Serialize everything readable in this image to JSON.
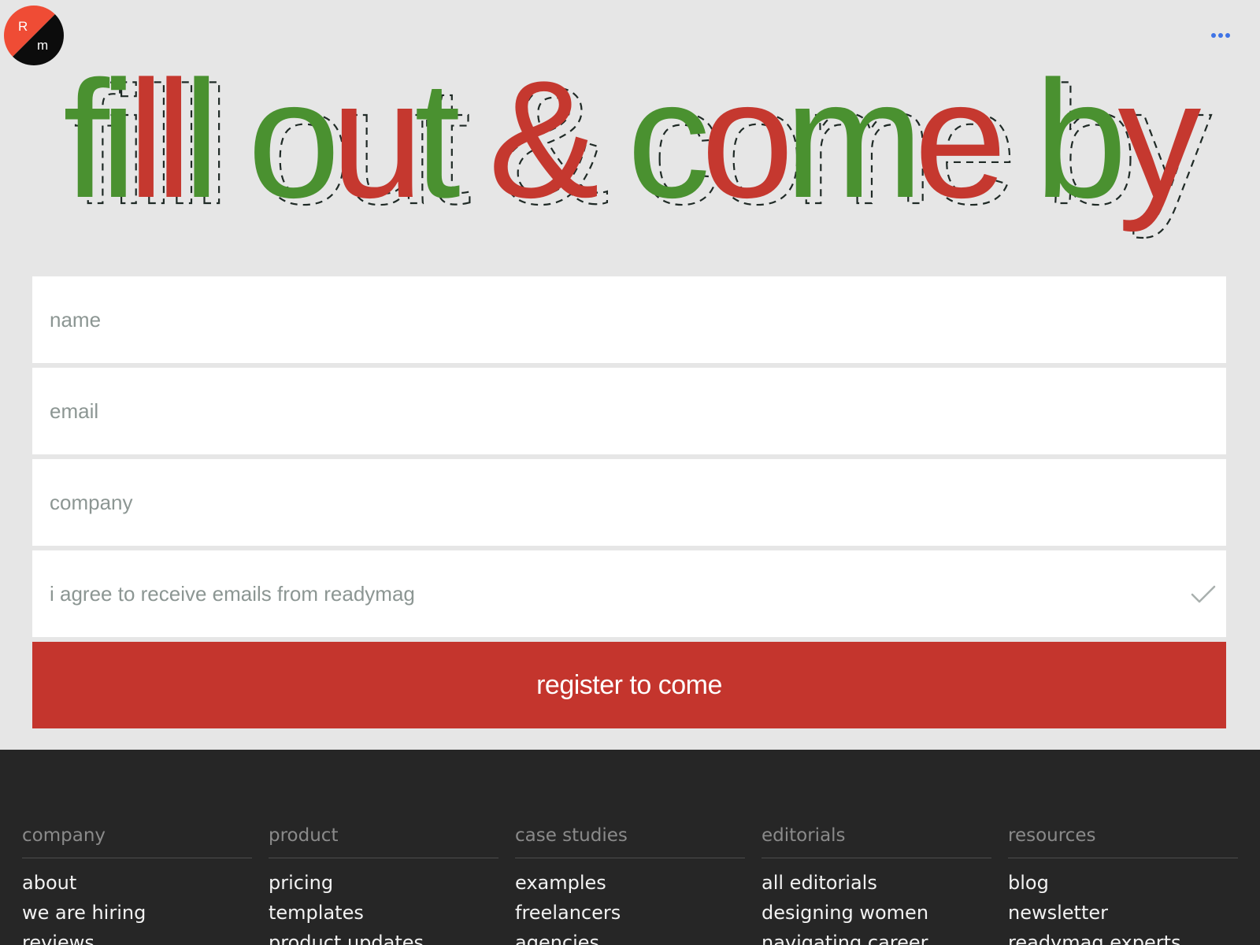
{
  "header": {
    "logo": {
      "letter_top": "R",
      "letter_bottom": "m"
    },
    "menu_icon": "more-horizontal-icon"
  },
  "hero": {
    "words": [
      {
        "text": "fi",
        "color": "#4a9130"
      },
      {
        "text": "ll",
        "color": "#c5382f"
      },
      {
        "text": "l",
        "color": "#4a9130"
      },
      {
        "text": " o",
        "color": "#4a9130"
      },
      {
        "text": "u",
        "color": "#c5382f"
      },
      {
        "text": "t",
        "color": "#4a9130"
      },
      {
        "text": " &",
        "color": "#c5382f"
      },
      {
        "text": " c",
        "color": "#4a9130"
      },
      {
        "text": "o",
        "color": "#c5382f"
      },
      {
        "text": "m",
        "color": "#4a9130"
      },
      {
        "text": "e",
        "color": "#c5382f"
      },
      {
        "text": " b",
        "color": "#4a9130"
      },
      {
        "text": "y",
        "color": "#c5382f"
      }
    ]
  },
  "form": {
    "name_placeholder": "name",
    "email_placeholder": "email",
    "company_placeholder": "company",
    "agree_label": "i agree to receive emails from readymag",
    "submit_label": "register to come"
  },
  "footer": {
    "columns": [
      {
        "heading": "company",
        "links": [
          "about",
          "we are hiring",
          "reviews"
        ]
      },
      {
        "heading": "product",
        "links": [
          "pricing",
          "templates",
          "product updates"
        ]
      },
      {
        "heading": "case studies",
        "links": [
          "examples",
          "freelancers",
          "agencies"
        ]
      },
      {
        "heading": "editorials",
        "links": [
          "all editorials",
          "designing women",
          "navigating career"
        ]
      },
      {
        "heading": "resources",
        "links": [
          "blog",
          "newsletter",
          "readymag experts"
        ]
      }
    ]
  },
  "colors": {
    "brand_red": "#c4352d",
    "brand_green": "#4a9130",
    "logo_orange": "#ef4c35",
    "logo_black": "#0c0c0c",
    "menu_blue": "#3f73e6",
    "page_bg": "#e6e6e6",
    "footer_bg": "#262626"
  }
}
